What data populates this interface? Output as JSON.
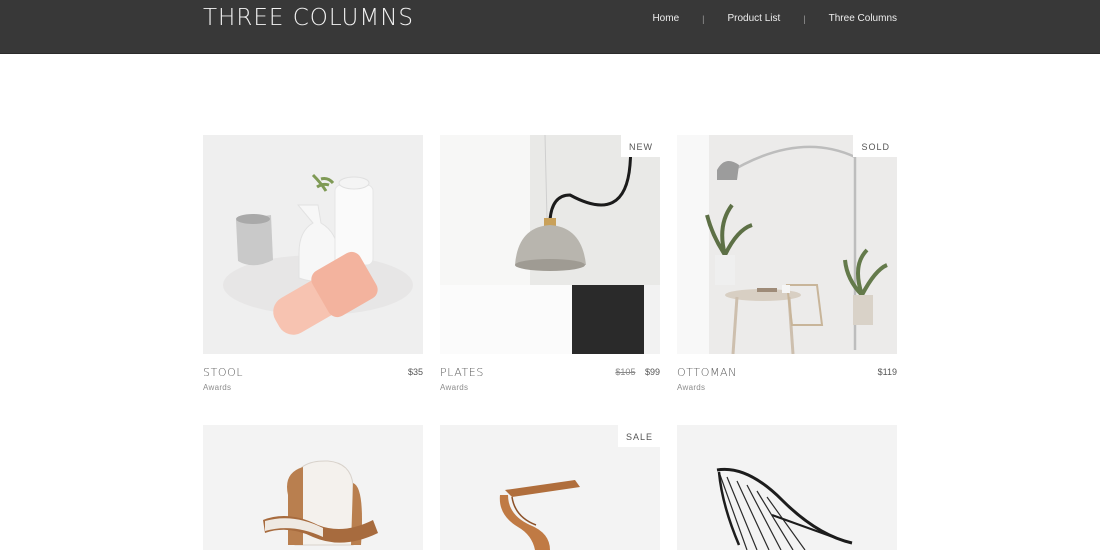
{
  "header": {
    "title": "THREE COLUMNS",
    "nav": [
      {
        "label": "Home"
      },
      {
        "label": "Product List"
      },
      {
        "label": "Three Columns"
      }
    ],
    "separator": "|"
  },
  "products": [
    {
      "name": "STOOL",
      "category": "Awards",
      "price": "$35",
      "old_price": "",
      "badge": "",
      "image": "vases-image"
    },
    {
      "name": "PLATES",
      "category": "Awards",
      "price": "$99",
      "old_price": "$105",
      "badge": "NEW",
      "image": "pendant-lamp-image"
    },
    {
      "name": "OTTOMAN",
      "category": "Awards",
      "price": "$119",
      "old_price": "",
      "badge": "SOLD",
      "image": "dining-room-image"
    },
    {
      "name": "",
      "category": "",
      "price": "",
      "old_price": "",
      "badge": "",
      "image": "shell-chair-image"
    },
    {
      "name": "",
      "category": "",
      "price": "",
      "old_price": "",
      "badge": "SALE",
      "image": "wooden-side-table-image"
    },
    {
      "name": "",
      "category": "",
      "price": "",
      "old_price": "",
      "badge": "",
      "image": "wire-chair-image"
    }
  ],
  "colors": {
    "header_bg": "#383838",
    "header_text": "#f2f2f2",
    "page_bg": "#ffffff"
  }
}
